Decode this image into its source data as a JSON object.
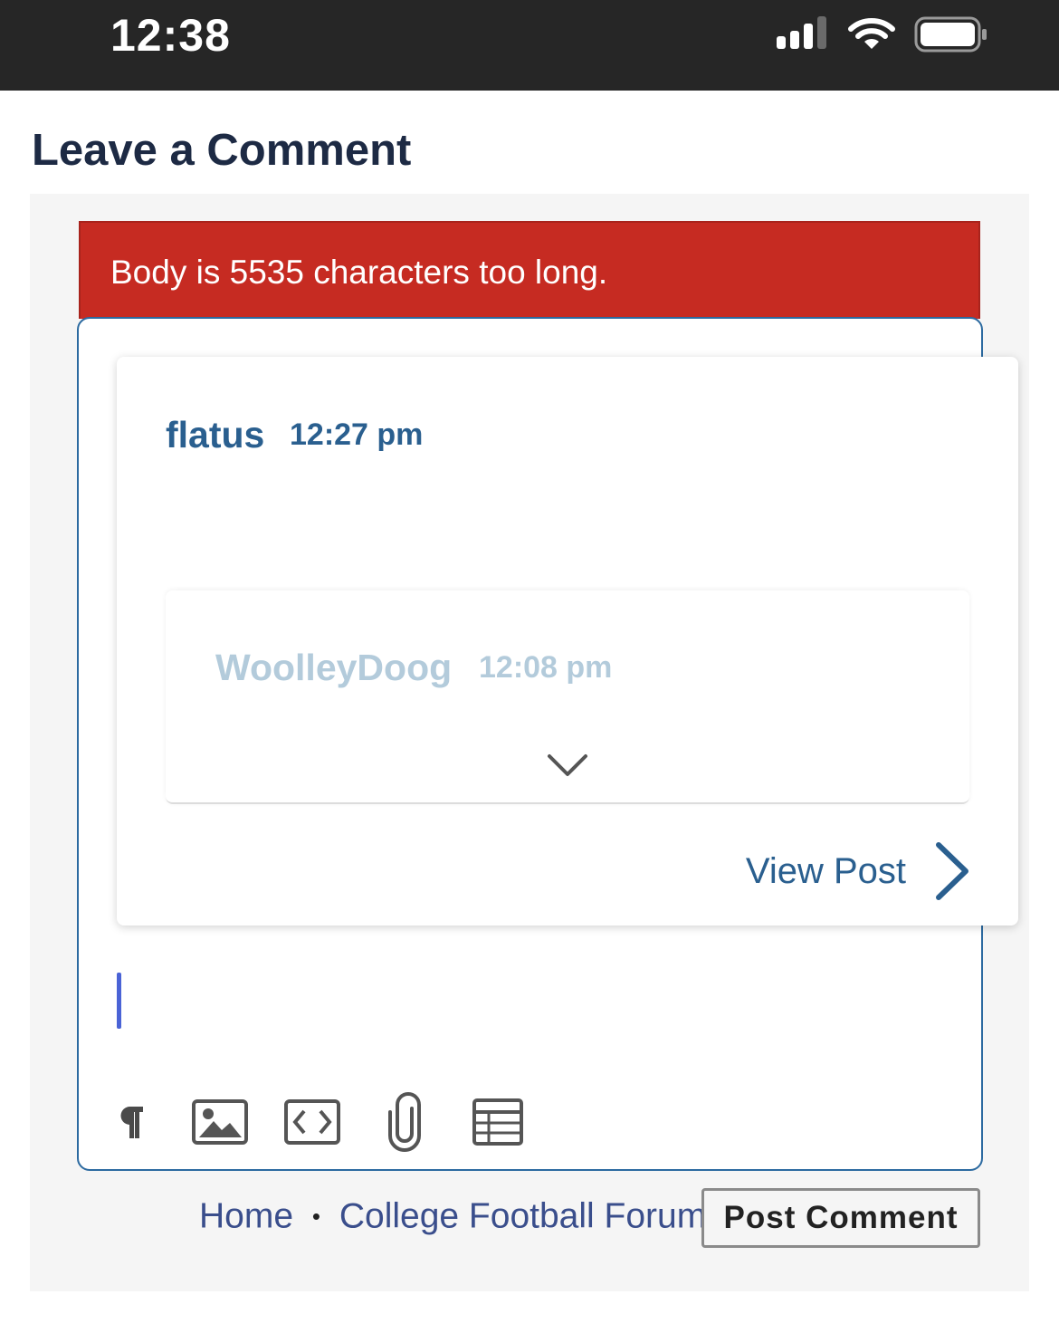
{
  "status_bar": {
    "time": "12:38",
    "icons": [
      "signal-icon",
      "wifi-icon",
      "battery-icon"
    ]
  },
  "page": {
    "title": "Leave a Comment"
  },
  "error": {
    "message": "Body is 5535 characters too long.",
    "color": "#c62b22"
  },
  "quote": {
    "author": "flatus",
    "time": "12:27 pm",
    "nested": {
      "author": "WoolleyDoog",
      "time": "12:08 pm"
    },
    "view_post_label": "View Post"
  },
  "toolbar": {
    "tools": [
      "paragraph-icon",
      "image-icon",
      "code-icon",
      "attachment-icon",
      "table-icon"
    ]
  },
  "footer": {
    "home_link": "Home",
    "separator": "•",
    "forum_link": "College Football Forum",
    "post_button": "Post Comment"
  },
  "colors": {
    "accent": "#2a5f8f",
    "title": "#1d2a44",
    "editor_border": "#2c6aa0"
  }
}
